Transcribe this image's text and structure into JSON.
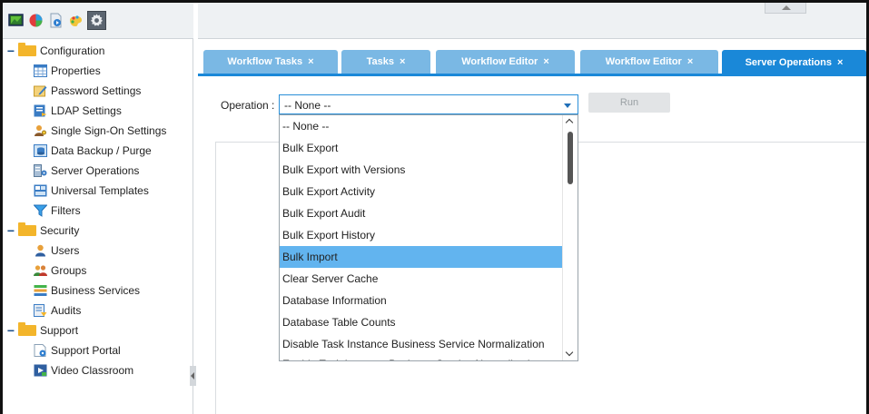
{
  "sidebar": {
    "toolbar_icons": [
      "monitor-icon",
      "pie-chart-icon",
      "document-play-icon",
      "palette-icon",
      "gear-icon"
    ],
    "tree": {
      "configuration": {
        "label": "Configuration",
        "items": [
          "Properties",
          "Password Settings",
          "LDAP Settings",
          "Single Sign-On Settings",
          "Data Backup / Purge",
          "Server Operations",
          "Universal Templates",
          "Filters"
        ]
      },
      "security": {
        "label": "Security",
        "items": [
          "Users",
          "Groups",
          "Business Services",
          "Audits"
        ]
      },
      "support": {
        "label": "Support",
        "items": [
          "Support Portal",
          "Video Classroom"
        ]
      }
    }
  },
  "tabs": [
    {
      "label": "Workflow Tasks",
      "close": "×"
    },
    {
      "label": "Tasks",
      "close": "×"
    },
    {
      "label": "Workflow Editor",
      "close": "×"
    },
    {
      "label": "Workflow Editor",
      "close": "×"
    },
    {
      "label": "Server Operations",
      "close": "×"
    }
  ],
  "operation": {
    "label": "Operation :",
    "selected": "-- None --",
    "run_label": "Run",
    "options": [
      "-- None --",
      "Bulk Export",
      "Bulk Export with Versions",
      "Bulk Export Activity",
      "Bulk Export Audit",
      "Bulk Export History",
      "Bulk Import",
      "Clear Server Cache",
      "Database Information",
      "Database Table Counts",
      "Disable Task Instance Business Service Normalization",
      "Enable Task Instance Business Service Normalization"
    ],
    "highlighted": "Bulk Import"
  },
  "colors": {
    "tab_active": "#1a88d8",
    "tab_inactive": "#7ab8e4",
    "highlight": "#62b4ef",
    "folder": "#f3b52b"
  }
}
